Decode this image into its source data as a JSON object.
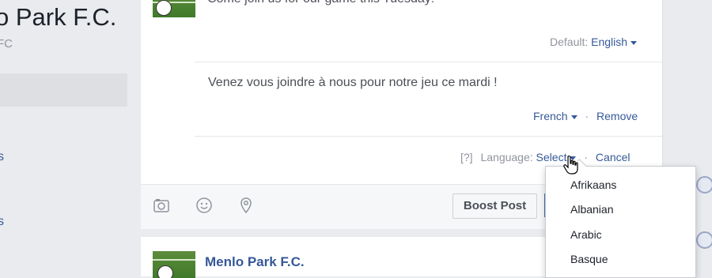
{
  "sidebar": {
    "page_name": "o Park F.C.",
    "page_handle": "FC",
    "fragments": [
      "s",
      "s"
    ]
  },
  "composer": {
    "top_text": "Come join us for our game this Tuesday!",
    "default_prefix": "Default:",
    "default_language": "English",
    "french_text": "Venez vous joindre à nous pour notre jeu ce mardi !",
    "french_language": "French",
    "separator": "·",
    "remove_label": "Remove",
    "help_label": "[?]",
    "language_prefix": "Language:",
    "select_label": "Select",
    "cancel_label": "Cancel"
  },
  "toolbar": {
    "boost_label": "Boost Post",
    "icons": [
      "camera-icon",
      "emoji-icon",
      "location-icon"
    ]
  },
  "feed": {
    "author": "Menlo Park F.C."
  },
  "language_dropdown": {
    "options": [
      "Afrikaans",
      "Albanian",
      "Arabic",
      "Basque"
    ]
  },
  "colors": {
    "link": "#365899",
    "background": "#e9ebee",
    "muted": "#90949c"
  }
}
